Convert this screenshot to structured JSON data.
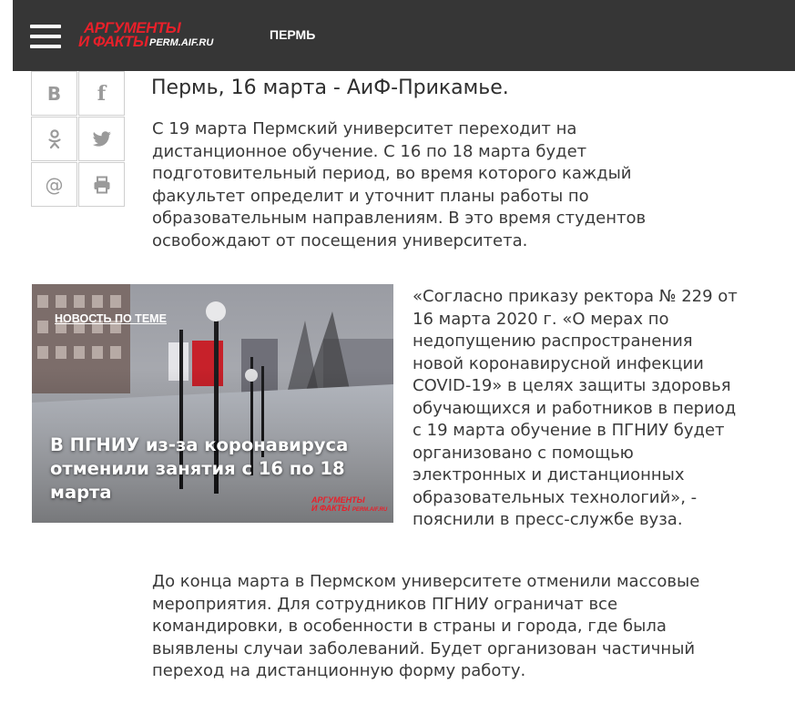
{
  "header": {
    "logo_line1": "АРГУМЕНТЫ",
    "logo_line2": "И ФАКТЫ",
    "logo_domain": "PERM.AIF.RU",
    "city": "ПЕРМЬ",
    "bg_color": "#363636",
    "brand_color": "#e8202a"
  },
  "share": {
    "vk": "B",
    "facebook": "f",
    "ok_icon": "odnoklassniki-icon",
    "twitter_icon": "twitter-icon",
    "email": "@",
    "print_icon": "print-icon"
  },
  "article": {
    "lead": "Пермь, 16 марта - АиФ-Прикамье.",
    "p1_lines": [
      "С 19 марта Пермский университет переходит на",
      "дистанционное обучение. С 16 по 18 марта будет",
      "подготовительный период, во время которого каждый",
      "факультет определит и уточнит планы работы по",
      "образовательным направлениям. В это время студентов",
      "освобождают от посещения университета."
    ],
    "quote_lines": [
      "«Согласно приказу ректора № 229 от",
      "16 марта 2020 г. «О мерах по",
      "недопущению распространения",
      "новой коронавирусной инфекции",
      "COVID-19» в целях защиты здоровья",
      "обучающихся и работников в период",
      "с 19 марта обучение в ПГНИУ будет",
      "организовано с помощью",
      "электронных и дистанционных",
      "образовательных технологий», -",
      "пояснили в пресс-службе вуза."
    ],
    "p3_lines": [
      "До конца марта в Пермском университете отменили массовые",
      "мероприятия. Для сотрудников ПГНИУ ограничат все",
      "командировки, в особенности в страны и города, где была",
      "выявлены случаи заболеваний. Будет организован частичный",
      "переход на дистанционную форму работу."
    ]
  },
  "related": {
    "tag": "НОВОСТЬ ПО ТЕМЕ",
    "title_lines": [
      "В ПГНИУ из-за коронавируса",
      "отменили занятия с 16 по 18",
      "марта"
    ],
    "logo_line1": "АРГУМЕНТЫ",
    "logo_line2": "И ФАКТЫ",
    "logo_domain": "PERM.AIF.RU"
  }
}
